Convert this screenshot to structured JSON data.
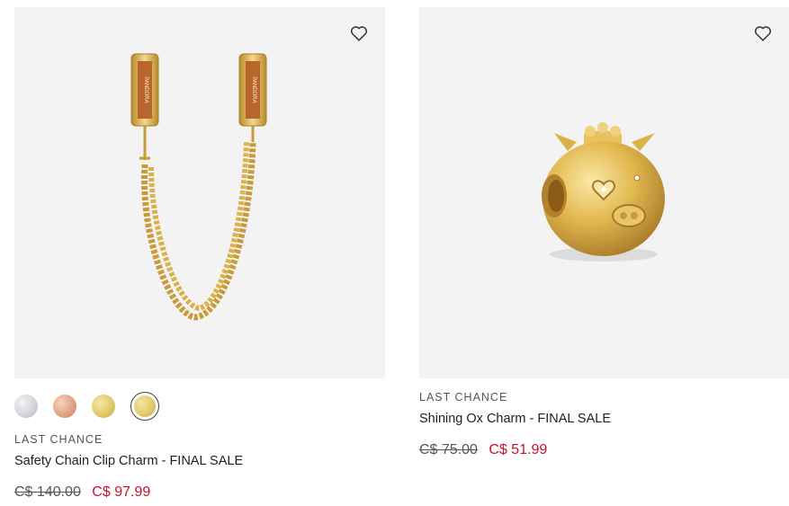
{
  "products": [
    {
      "badge": "LAST CHANCE",
      "title": "Safety Chain Clip Charm - FINAL SALE",
      "old_price": "C$ 140.00",
      "new_price": "C$ 97.99",
      "image_text": "PANDORA",
      "swatches": [
        "silver",
        "rose-gold",
        "gold",
        "gold-selected"
      ]
    },
    {
      "badge": "LAST CHANCE",
      "title": "Shining Ox Charm - FINAL SALE",
      "old_price": "C$ 75.00",
      "new_price": "C$ 51.99"
    }
  ],
  "colors": {
    "sale_red": "#c8102e",
    "image_bg": "#f3f3f3",
    "gold": "#d9b24a"
  },
  "icons": {
    "wishlist": "heart-outline-icon"
  }
}
